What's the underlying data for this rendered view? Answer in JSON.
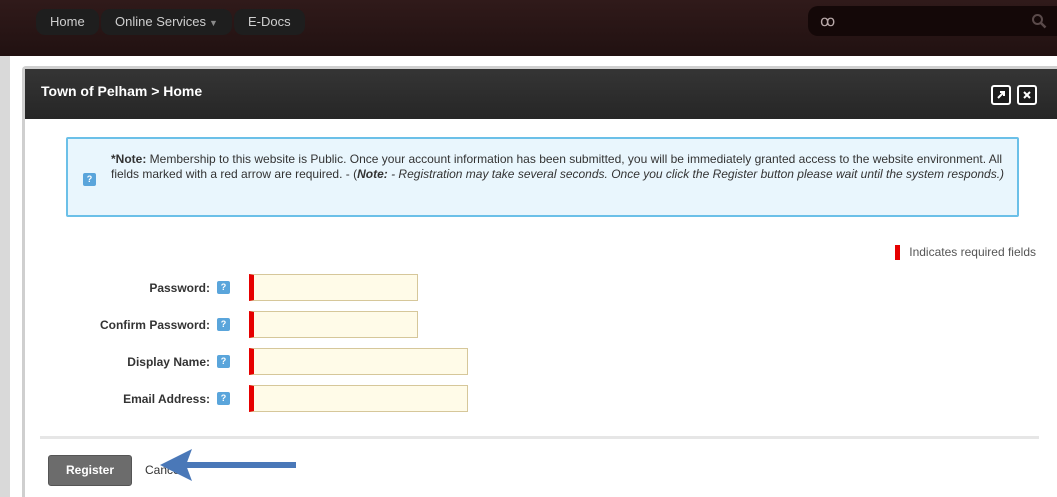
{
  "nav": {
    "items": [
      {
        "label": "Home"
      },
      {
        "label": "Online Services",
        "has_dropdown": true
      },
      {
        "label": "E-Docs"
      }
    ],
    "search_logo_icon": "site-logo-icon",
    "search_icon": "search-icon"
  },
  "modal": {
    "title": "Town of Pelham > Home",
    "maximize_icon": "maximize-icon",
    "close_icon": "close-icon"
  },
  "note": {
    "label": "*Note:",
    "text_1": " Membership to this website is Public. Once your account information has been submitted, you will be immediately granted access to the website environment. All fields marked with a red arrow are required. - (",
    "label_2": "Note:",
    "text_2": " - Registration may take several seconds. Once you click the Register button please wait until the system responds.)"
  },
  "required_legend": "Indicates required fields",
  "form": {
    "fields": [
      {
        "label": "Password:",
        "value": ""
      },
      {
        "label": "Confirm Password:",
        "value": ""
      },
      {
        "label": "Display Name:",
        "value": ""
      },
      {
        "label": "Email Address:",
        "value": ""
      }
    ],
    "help_icon": "help-icon"
  },
  "actions": {
    "register_label": "Register",
    "cancel_label": "Cancel"
  },
  "colors": {
    "accent_red": "#e60000",
    "note_border": "#6bc0e8",
    "annotation_arrow": "#4a78b8"
  }
}
